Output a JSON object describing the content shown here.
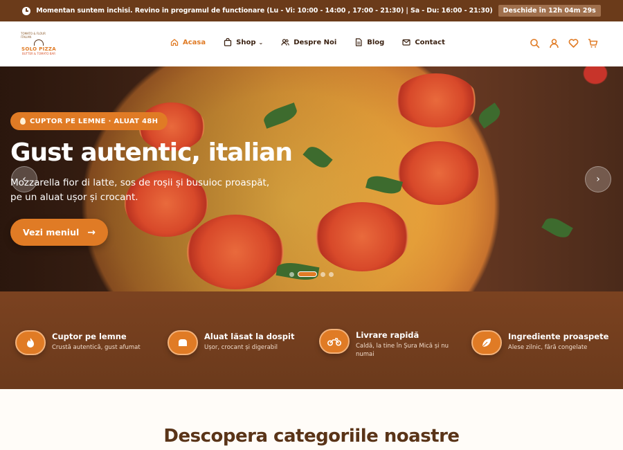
{
  "topbar": {
    "message": "Momentan suntem inchisi. Revino in programul de functionare (Lu - Vi: 10:00 - 14:00 , 17:00 - 21:30) | Sa - Du: 16:00 - 21:30)",
    "countdown": "Deschide în 12h 04m 29s"
  },
  "header": {
    "logo": {
      "name": "SOLO PIZZA",
      "ring_top": "TOMATO & FLOUR ITALIAN",
      "ring_bottom": "BUTTER & TOMATO BAR"
    },
    "nav": [
      {
        "label": "Acasa",
        "icon": "home-icon",
        "active": true
      },
      {
        "label": "Shop",
        "icon": "bag-icon",
        "dropdown": true
      },
      {
        "label": "Despre Noi",
        "icon": "users-icon"
      },
      {
        "label": "Blog",
        "icon": "document-icon"
      },
      {
        "label": "Contact",
        "icon": "mail-icon"
      }
    ],
    "tools": [
      "search-icon",
      "user-icon",
      "heart-icon",
      "cart-icon"
    ]
  },
  "hero": {
    "tag": "CUPTOR PE LEMNE · ALUAT 48H",
    "title": "Gust autentic, italian",
    "description": "Mozzarella fior di latte, sos de roșii și busuioc proaspăt, pe un aluat ușor și crocant.",
    "cta": "Vezi meniul",
    "prev_glyph": "‹",
    "next_glyph": "›",
    "slides": 4,
    "active_slide": 2
  },
  "features": [
    {
      "title": "Cuptor pe lemne",
      "subtitle": "Crustă autentică, gust afumat",
      "icon": "flame-icon"
    },
    {
      "title": "Aluat lăsat la dospit",
      "subtitle": "Ușor, crocant și digerabil",
      "icon": "bread-icon"
    },
    {
      "title": "Livrare rapidă",
      "subtitle": "Caldă, la tine în Șura Mică și nu numai",
      "icon": "motorbike-icon"
    },
    {
      "title": "Ingrediente proaspete",
      "subtitle": "Alese zilnic, fără congelate",
      "icon": "leaf-icon"
    }
  ],
  "categories": {
    "title": "Descopera categoriile noastre"
  },
  "colors": {
    "accent": "#e07b25",
    "brown_dark": "#6b3b1a",
    "text_dark": "#3b2212"
  }
}
